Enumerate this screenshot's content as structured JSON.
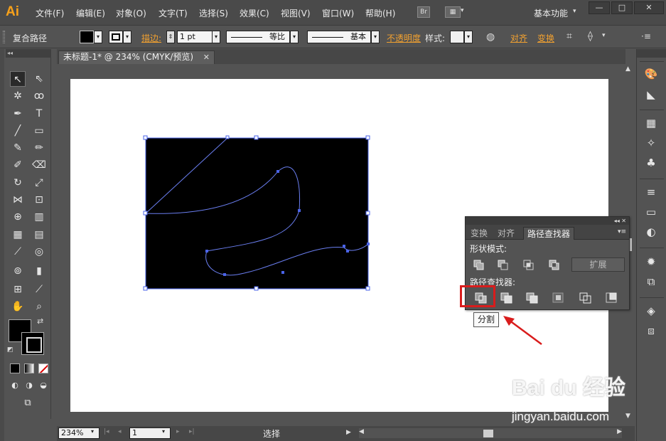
{
  "app": {
    "logo": "Ai",
    "menus": [
      "文件(F)",
      "编辑(E)",
      "对象(O)",
      "文字(T)",
      "选择(S)",
      "效果(C)",
      "视图(V)",
      "窗口(W)",
      "帮助(H)"
    ],
    "bridge_label": "Br",
    "workspace": "基本功能",
    "workspace_arrow": "▾",
    "window_buttons": [
      "—",
      "□",
      "✕"
    ]
  },
  "control_bar": {
    "selection_type": "复合路径",
    "stroke_label": "描边:",
    "stroke_weight": "1 pt",
    "profile_label": "等比",
    "brush_label": "基本",
    "opacity_label": "不透明度",
    "style_label": "样式:",
    "align_label": "对齐",
    "transform_label": "变换"
  },
  "document": {
    "tab_title": "未标题-1* @ 234% (CMYK/预览)",
    "tab_close": "✕"
  },
  "status_bar": {
    "zoom": "234%",
    "page": "1",
    "mode": "选择"
  },
  "pathfinder_panel": {
    "top_controls": "◂◂ ✕",
    "tabs": [
      "变换",
      "对齐",
      "路径查找器"
    ],
    "active_tab": 2,
    "menu_icon": "▾≡",
    "shape_modes_label": "形状模式:",
    "pathfinders_label": "路径查找器:",
    "expand_button": "扩展",
    "shape_mode_icons": [
      "unite-icon",
      "minus-front-icon",
      "intersect-icon",
      "exclude-icon"
    ],
    "pathfinder_icons": [
      "divide-icon",
      "trim-icon",
      "merge-icon",
      "crop-icon",
      "outline-icon",
      "minus-back-icon"
    ],
    "tooltip": "分割"
  },
  "colors": {
    "accent_orange": "#f0a030",
    "highlight_red": "#d91c1c",
    "selection_blue": "#4a63e8",
    "artwork_fill": "#000000"
  },
  "watermark": {
    "brand": "Bai du 经验",
    "url": "jingyan.baidu.com"
  }
}
